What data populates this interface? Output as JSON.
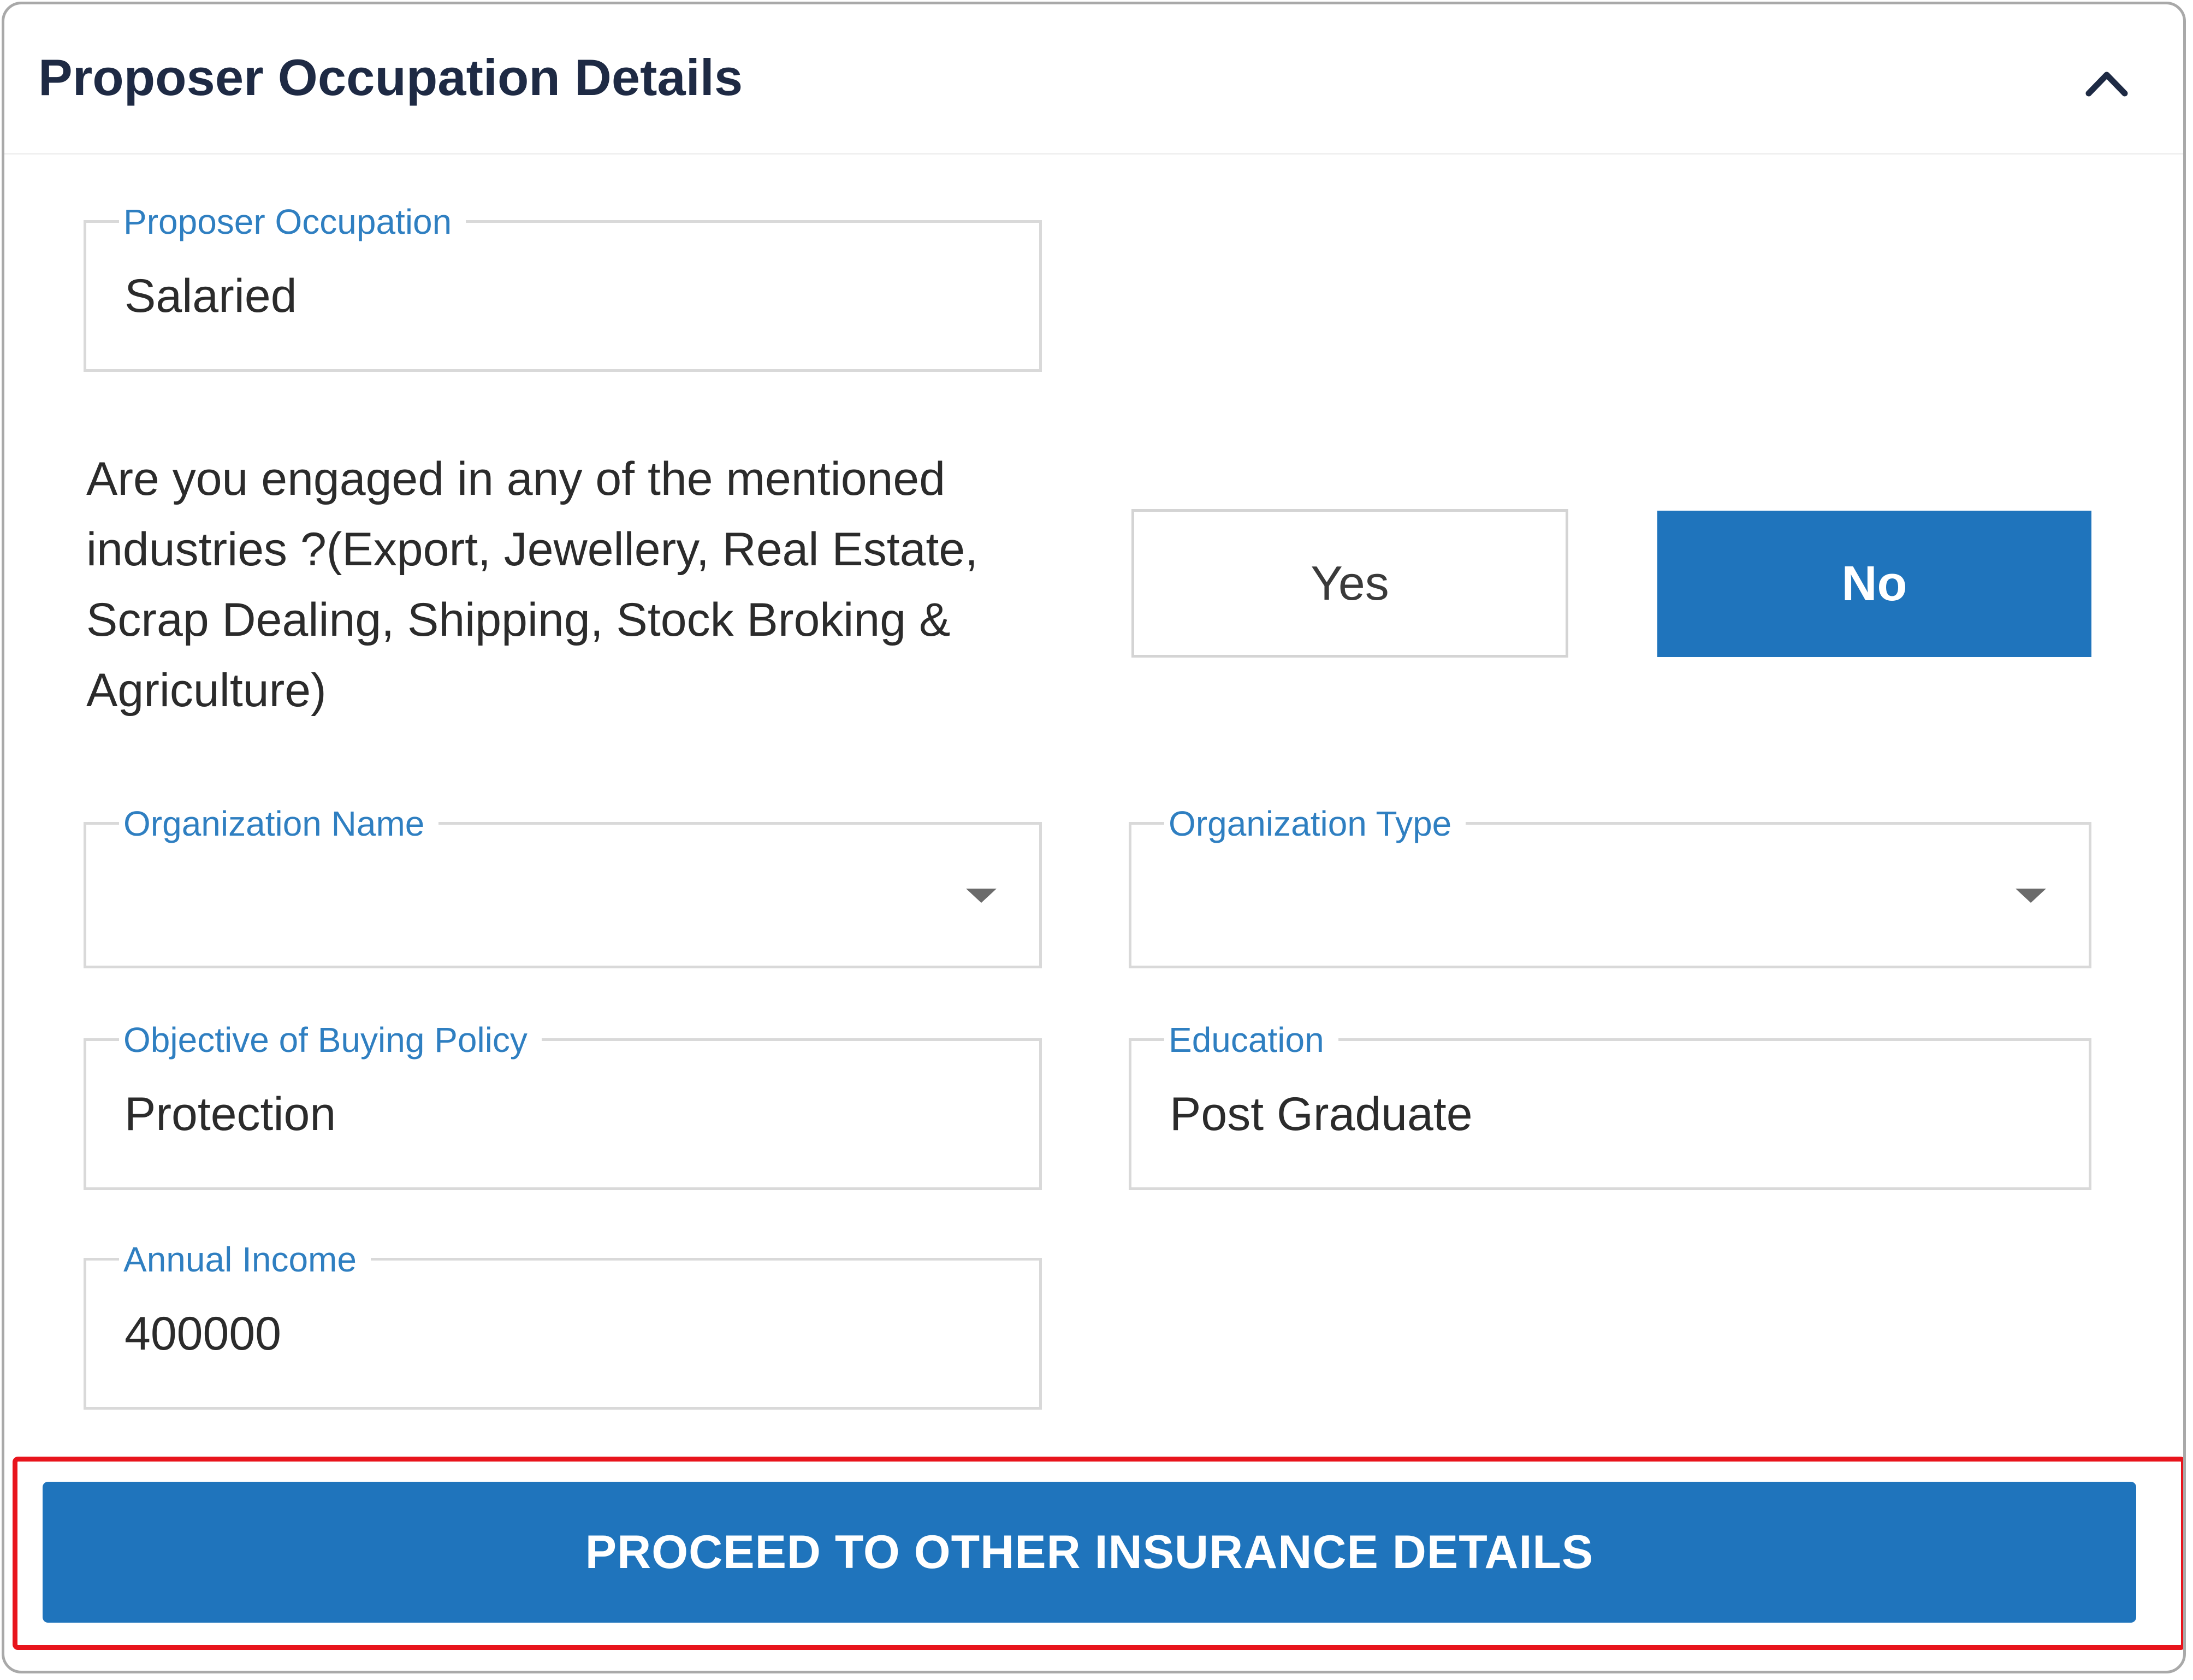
{
  "section": {
    "title": "Proposer Occupation Details"
  },
  "fields": {
    "occupation": {
      "label": "Proposer Occupation",
      "value": "Salaried"
    },
    "organization_name": {
      "label": "Organization Name",
      "value": ""
    },
    "organization_type": {
      "label": "Organization Type",
      "value": ""
    },
    "objective": {
      "label": "Objective of Buying Policy",
      "value": "Protection"
    },
    "education": {
      "label": "Education",
      "value": "Post Graduate"
    },
    "annual_income": {
      "label": "Annual Income",
      "value": "400000"
    }
  },
  "industry_question": {
    "text": "Are you engaged in any of the mentioned industries ?(Export, Jewellery, Real Estate, Scrap Dealing, Shipping, Stock Broking & Agriculture)",
    "yes_label": "Yes",
    "no_label": "No",
    "selected": "No"
  },
  "actions": {
    "proceed_label": "PROCEED TO OTHER INSURANCE DETAILS"
  },
  "colors": {
    "primary": "#1f74bc",
    "label_blue": "#2f7fc1",
    "highlight_red": "#e8141c",
    "title_text": "#1e2a44"
  },
  "icons": {
    "collapse": "chevron-up-icon",
    "dropdown": "caret-down-icon"
  }
}
